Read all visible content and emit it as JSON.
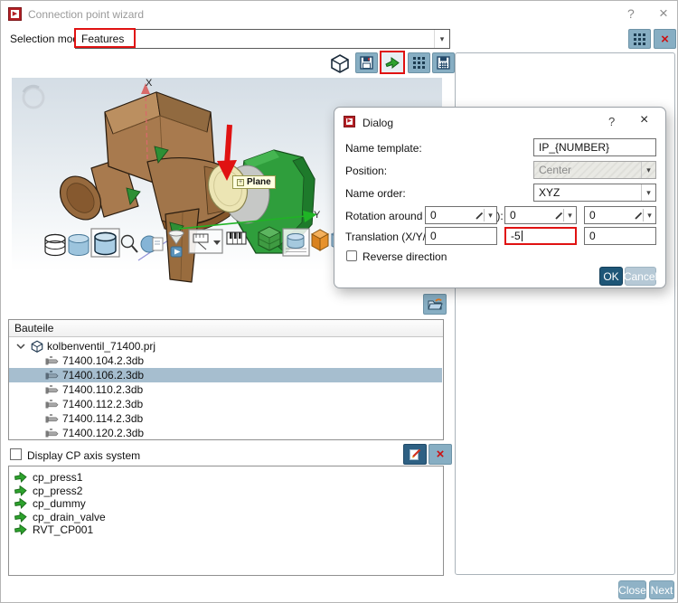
{
  "window": {
    "title": "Connection point wizard",
    "help_glyph": "?",
    "close_glyph": "×"
  },
  "selection_mode": {
    "label": "Selection mode:",
    "value": "Features",
    "dropdown_glyph": "▾"
  },
  "top_right_buttons": [
    "grid-select",
    "delete"
  ],
  "top_toolbar_icons": [
    "view-cube",
    "save-scene",
    "apply-direction",
    "point-grid",
    "save-grid"
  ],
  "viewport": {
    "axis_x_label": "X",
    "axis_y_label": "Y",
    "tooltip": {
      "icon_glyph": "+",
      "text": "Plane"
    },
    "bottom_toolbar_icons": [
      "cylinder-wireframe",
      "cylinder-shaded",
      "cylinder-selected",
      "zoom",
      "sphere-document",
      "cone-play",
      "measure-dropdown",
      "scale-ruler",
      "mesh-cube",
      "cylinder-grid",
      "orange-box",
      "blue-cube"
    ]
  },
  "folder_button": "load-folder",
  "parts_tree": {
    "header": "Bauteile",
    "root": {
      "label": "kolbenventil_71400.prj",
      "expanded": true
    },
    "items": [
      {
        "label": "71400.104.2.3db",
        "selected": false
      },
      {
        "label": "71400.106.2.3db",
        "selected": true
      },
      {
        "label": "71400.110.2.3db",
        "selected": false
      },
      {
        "label": "71400.112.2.3db",
        "selected": false
      },
      {
        "label": "71400.114.2.3db",
        "selected": false
      },
      {
        "label": "71400.120.2.3db",
        "selected": false
      }
    ]
  },
  "cp_section": {
    "checkbox_label": "Display CP axis system",
    "checkbox_checked": false,
    "buttons": [
      "edit-cp",
      "delete-cp"
    ],
    "items": [
      "cp_press1",
      "cp_press2",
      "cp_dummy",
      "cp_drain_valve",
      "RVT_CP001"
    ]
  },
  "dialog": {
    "title": "Dialog",
    "help_glyph": "?",
    "close_glyph": "×",
    "name_template": {
      "label": "Name template:",
      "value": "IP_{NUMBER}"
    },
    "position": {
      "label": "Position:",
      "value": "Center",
      "disabled": true
    },
    "name_order": {
      "label": "Name order:",
      "value": "XYZ"
    },
    "rotation": {
      "label": "Rotation around the axis (X/Y/Z):",
      "values": [
        "0",
        "0",
        "0"
      ]
    },
    "translation": {
      "label": "Translation (X/Y/Z):",
      "values": [
        "0",
        "-5",
        "0"
      ],
      "highlighted_index": 1
    },
    "reverse_checkbox": {
      "label": "Reverse direction",
      "checked": false
    },
    "ok_label": "OK",
    "cancel_label": "Cancel",
    "dropdown_glyph": "▾"
  },
  "footer": {
    "close_label": "Close",
    "next_label": "Next"
  },
  "colors": {
    "annotation_red": "#e01212",
    "selection_blue": "#a6becf",
    "ok_button": "#1e5677",
    "steel_button": "#87aec3",
    "footer_button": "#8fb2c6"
  }
}
